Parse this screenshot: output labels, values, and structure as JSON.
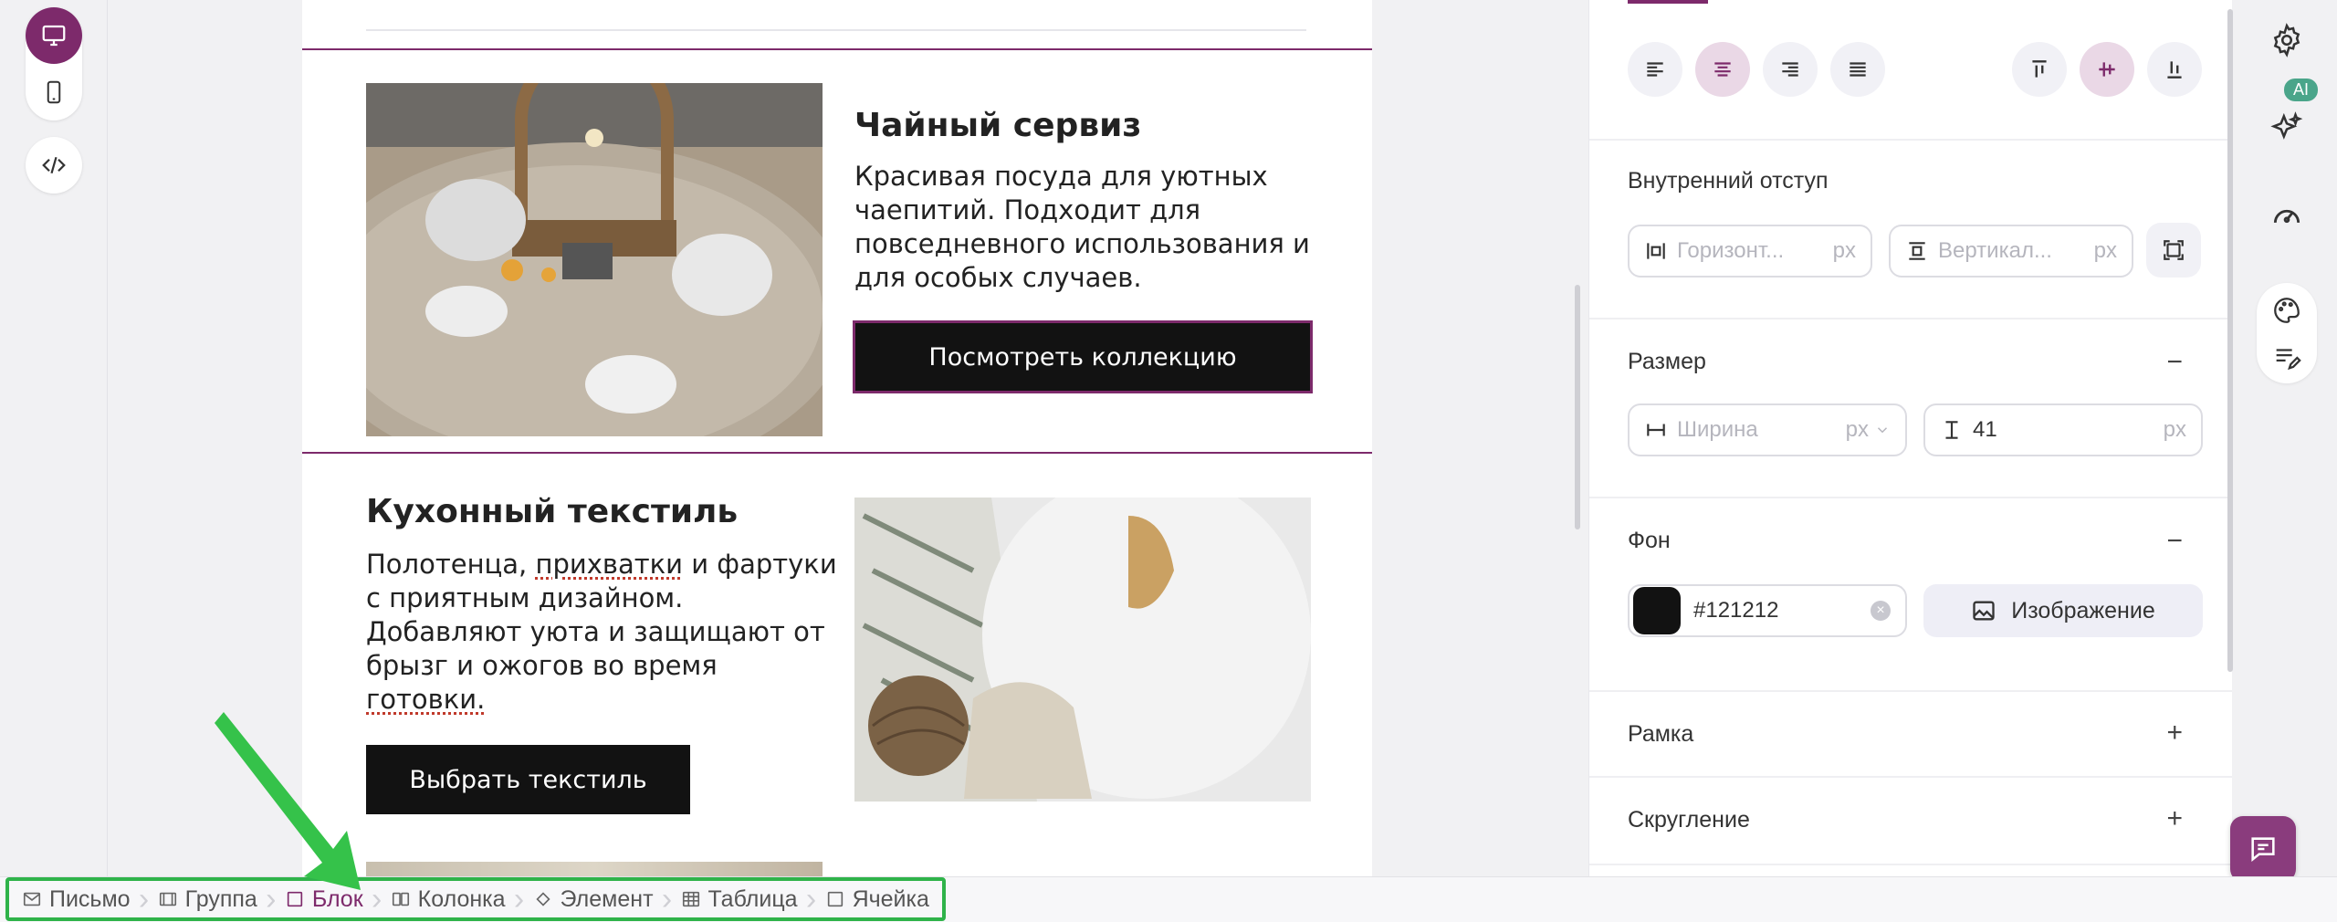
{
  "email": {
    "blocks": [
      {
        "title": "Чайный сервиз",
        "lines": [
          "Красивая посуда для уютных",
          "чаепитий. Подходит для",
          "повседневного использования и",
          "для особых случаев."
        ],
        "button": "Посмотреть коллекцию"
      },
      {
        "title": "Кухонный текстиль",
        "line1_a": "Полотенца, ",
        "line1_b": "прихватки",
        "line1_c": " и фартуки",
        "lines": [
          "с приятным дизайном.",
          "Добавляют уюта и защищают от",
          "брызг и ожогов во время"
        ],
        "last_line": "готовки.",
        "button": "Выбрать текстиль"
      }
    ]
  },
  "panel": {
    "padding": {
      "title": "Внутренний отступ",
      "horizontal_placeholder": "Горизонт...",
      "vertical_placeholder": "Вертикал...",
      "unit": "px"
    },
    "size": {
      "title": "Размер",
      "toggle": "−",
      "width_placeholder": "Ширина",
      "height_value": "41",
      "unit": "px"
    },
    "background": {
      "title": "Фон",
      "toggle": "−",
      "color_value": "#121212",
      "image_button": "Изображение"
    },
    "border": {
      "title": "Рамка",
      "toggle": "+"
    },
    "radius": {
      "title": "Скругление",
      "toggle": "+"
    }
  },
  "tools": {
    "ai_badge": "AI"
  },
  "breadcrumb": [
    {
      "label": "Письмо",
      "icon": "envelope-icon"
    },
    {
      "label": "Группа",
      "icon": "group-icon"
    },
    {
      "label": "Блок",
      "icon": "square-icon",
      "active": true
    },
    {
      "label": "Колонка",
      "icon": "columns-icon"
    },
    {
      "label": "Элемент",
      "icon": "diamond-icon"
    },
    {
      "label": "Таблица",
      "icon": "table-icon"
    },
    {
      "label": "Ячейка",
      "icon": "square-icon"
    }
  ],
  "colors": {
    "accent": "#7d2a6b",
    "button_bg": "#121212",
    "annotation": "#2fb34a"
  }
}
